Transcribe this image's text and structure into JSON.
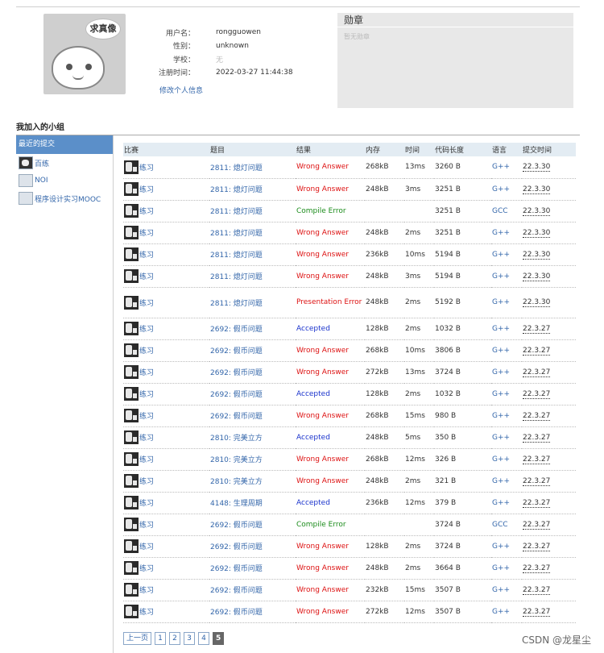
{
  "profile": {
    "avatar_text": "求真像",
    "fields": [
      {
        "label": "用户名：",
        "value": "rongguowen"
      },
      {
        "label": "性别：",
        "value": "unknown"
      },
      {
        "label": "学校：",
        "value": "无"
      },
      {
        "label": "注册时间：",
        "value": "2022-03-27 11:44:38"
      }
    ],
    "edit_link": "修改个人信息"
  },
  "badges": {
    "title": "勋章",
    "empty_text": "暂无勋章"
  },
  "groups": {
    "title": "我加入的小组",
    "header": "最近的提交",
    "items": [
      {
        "label": "百练",
        "icon": "bailian-icon"
      },
      {
        "label": "NOI",
        "icon": "noi-icon"
      },
      {
        "label": "程序设计实习MOOC",
        "icon": "mooc-icon"
      }
    ]
  },
  "table": {
    "headers": [
      "比赛",
      "题目",
      "结果",
      "内存",
      "时间",
      "代码长度",
      "语言",
      "提交时间"
    ],
    "rows": [
      {
        "contest": "练习",
        "problem": "2811: 熄灯问题",
        "result": "Wrong Answer",
        "status": "wa",
        "memory": "268kB",
        "time": "13ms",
        "length": "3260 B",
        "lang": "G++",
        "submitted": "22.3.30"
      },
      {
        "contest": "练习",
        "problem": "2811: 熄灯问题",
        "result": "Wrong Answer",
        "status": "wa",
        "memory": "248kB",
        "time": "3ms",
        "length": "3251 B",
        "lang": "G++",
        "submitted": "22.3.30"
      },
      {
        "contest": "练习",
        "problem": "2811: 熄灯问题",
        "result": "Compile Error",
        "status": "ce",
        "memory": "",
        "time": "",
        "length": "3251 B",
        "lang": "GCC",
        "submitted": "22.3.30"
      },
      {
        "contest": "练习",
        "problem": "2811: 熄灯问题",
        "result": "Wrong Answer",
        "status": "wa",
        "memory": "248kB",
        "time": "2ms",
        "length": "3251 B",
        "lang": "G++",
        "submitted": "22.3.30"
      },
      {
        "contest": "练习",
        "problem": "2811: 熄灯问题",
        "result": "Wrong Answer",
        "status": "wa",
        "memory": "236kB",
        "time": "10ms",
        "length": "5194 B",
        "lang": "G++",
        "submitted": "22.3.30"
      },
      {
        "contest": "练习",
        "problem": "2811: 熄灯问题",
        "result": "Wrong Answer",
        "status": "wa",
        "memory": "248kB",
        "time": "3ms",
        "length": "5194 B",
        "lang": "G++",
        "submitted": "22.3.30"
      },
      {
        "contest": "练习",
        "problem": "2811: 熄灯问题",
        "result": "Presentation Error",
        "status": "pe",
        "memory": "248kB",
        "time": "2ms",
        "length": "5192 B",
        "lang": "G++",
        "submitted": "22.3.30"
      },
      {
        "contest": "练习",
        "problem": "2692: 假币问题",
        "result": "Accepted",
        "status": "ac",
        "memory": "128kB",
        "time": "2ms",
        "length": "1032 B",
        "lang": "G++",
        "submitted": "22.3.27"
      },
      {
        "contest": "练习",
        "problem": "2692: 假币问题",
        "result": "Wrong Answer",
        "status": "wa",
        "memory": "268kB",
        "time": "10ms",
        "length": "3806 B",
        "lang": "G++",
        "submitted": "22.3.27"
      },
      {
        "contest": "练习",
        "problem": "2692: 假币问题",
        "result": "Wrong Answer",
        "status": "wa",
        "memory": "272kB",
        "time": "13ms",
        "length": "3724 B",
        "lang": "G++",
        "submitted": "22.3.27"
      },
      {
        "contest": "练习",
        "problem": "2692: 假币问题",
        "result": "Accepted",
        "status": "ac",
        "memory": "128kB",
        "time": "2ms",
        "length": "1032 B",
        "lang": "G++",
        "submitted": "22.3.27"
      },
      {
        "contest": "练习",
        "problem": "2692: 假币问题",
        "result": "Wrong Answer",
        "status": "wa",
        "memory": "268kB",
        "time": "15ms",
        "length": "980 B",
        "lang": "G++",
        "submitted": "22.3.27"
      },
      {
        "contest": "练习",
        "problem": "2810: 完美立方",
        "result": "Accepted",
        "status": "ac",
        "memory": "248kB",
        "time": "5ms",
        "length": "350 B",
        "lang": "G++",
        "submitted": "22.3.27"
      },
      {
        "contest": "练习",
        "problem": "2810: 完美立方",
        "result": "Wrong Answer",
        "status": "wa",
        "memory": "268kB",
        "time": "12ms",
        "length": "326 B",
        "lang": "G++",
        "submitted": "22.3.27"
      },
      {
        "contest": "练习",
        "problem": "2810: 完美立方",
        "result": "Wrong Answer",
        "status": "wa",
        "memory": "248kB",
        "time": "2ms",
        "length": "321 B",
        "lang": "G++",
        "submitted": "22.3.27"
      },
      {
        "contest": "练习",
        "problem": "4148: 生理周期",
        "result": "Accepted",
        "status": "ac",
        "memory": "236kB",
        "time": "12ms",
        "length": "379 B",
        "lang": "G++",
        "submitted": "22.3.27"
      },
      {
        "contest": "练习",
        "problem": "2692: 假币问题",
        "result": "Compile Error",
        "status": "ce",
        "memory": "",
        "time": "",
        "length": "3724 B",
        "lang": "GCC",
        "submitted": "22.3.27"
      },
      {
        "contest": "练习",
        "problem": "2692: 假币问题",
        "result": "Wrong Answer",
        "status": "wa",
        "memory": "128kB",
        "time": "2ms",
        "length": "3724 B",
        "lang": "G++",
        "submitted": "22.3.27"
      },
      {
        "contest": "练习",
        "problem": "2692: 假币问题",
        "result": "Wrong Answer",
        "status": "wa",
        "memory": "248kB",
        "time": "2ms",
        "length": "3664 B",
        "lang": "G++",
        "submitted": "22.3.27"
      },
      {
        "contest": "练习",
        "problem": "2692: 假币问题",
        "result": "Wrong Answer",
        "status": "wa",
        "memory": "232kB",
        "time": "15ms",
        "length": "3507 B",
        "lang": "G++",
        "submitted": "22.3.27"
      },
      {
        "contest": "练习",
        "problem": "2692: 假币问题",
        "result": "Wrong Answer",
        "status": "wa",
        "memory": "272kB",
        "time": "12ms",
        "length": "3507 B",
        "lang": "G++",
        "submitted": "22.3.27"
      }
    ]
  },
  "pagination": {
    "prev": "上一页",
    "pages": [
      "1",
      "2",
      "3",
      "4",
      "5"
    ],
    "current": "5"
  },
  "watermark": "CSDN @龙星尘"
}
